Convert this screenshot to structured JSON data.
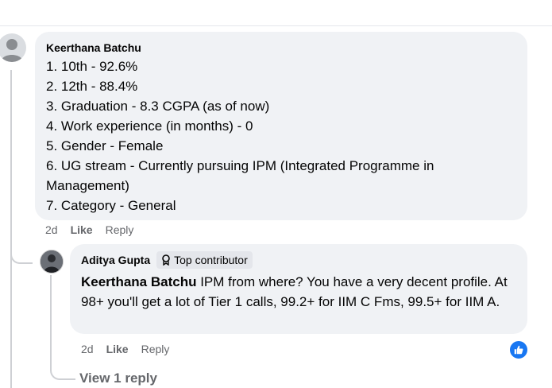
{
  "comment": {
    "author": "Keerthana Batchu",
    "lines": [
      "1. 10th - 92.6%",
      "2. 12th - 88.4%",
      "3. Graduation - 8.3 CGPA (as of now)",
      "4. Work experience (in months) - 0",
      "5. Gender - Female",
      "6. UG stream - Currently pursuing IPM (Integrated Programme in",
      "Management)",
      "7. Category - General"
    ],
    "time": "2d",
    "like_label": "Like",
    "reply_label": "Reply"
  },
  "reply": {
    "author": "Aditya Gupta",
    "badge": "Top contributor",
    "mention": "Keerthana Batchu",
    "text": " IPM from where? You have a very decent profile. At 98+ you'll get a lot of Tier 1 calls, 99.2+ for IIM C Fms, 99.5+ for IIM A.",
    "time": "2d",
    "like_label": "Like",
    "reply_label": "Reply",
    "reaction_icon": "thumbs-up-icon",
    "reaction_color": "#1877f2"
  },
  "view_replies": "View 1 reply"
}
